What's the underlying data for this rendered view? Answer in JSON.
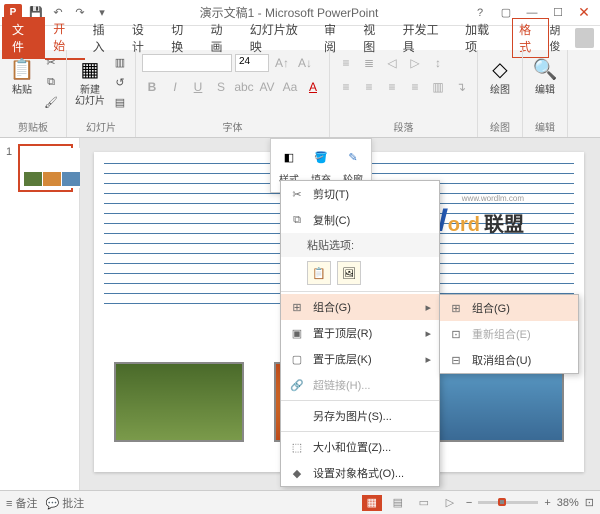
{
  "titlebar": {
    "title": "演示文稿1 - Microsoft PowerPoint",
    "app_letter": "P"
  },
  "tabs": {
    "file": "文件",
    "home": "开始",
    "insert": "插入",
    "design": "设计",
    "transitions": "切换",
    "animations": "动画",
    "slideshow": "幻灯片放映",
    "review": "审阅",
    "view": "视图",
    "developer": "开发工具",
    "addins": "加载项",
    "format": "格式",
    "username": "胡俊"
  },
  "ribbon": {
    "clipboard": {
      "label": "剪贴板",
      "paste": "粘贴"
    },
    "slides": {
      "label": "幻灯片",
      "new_slide": "新建\n幻灯片"
    },
    "font": {
      "label": "字体",
      "size": "24"
    },
    "paragraph": {
      "label": "段落"
    },
    "drawing": {
      "label": "绘图",
      "btn": "绘图"
    },
    "editing": {
      "label": "编辑",
      "btn": "编辑"
    }
  },
  "drawing_tools": {
    "style": "样式",
    "fill": "填充",
    "outline": "轮廓"
  },
  "context_menu": {
    "cut": "剪切(T)",
    "copy": "复制(C)",
    "paste_options": "粘贴选项:",
    "group": "组合(G)",
    "bring_front": "置于顶层(R)",
    "send_back": "置于底层(K)",
    "hyperlink": "超链接(H)...",
    "save_as_pic": "另存为图片(S)...",
    "size_position": "大小和位置(Z)...",
    "format_object": "设置对象格式(O)..."
  },
  "submenu": {
    "group": "组合(G)",
    "regroup": "重新组合(E)",
    "ungroup": "取消组合(U)"
  },
  "watermark": {
    "w": "W",
    "ord": "ord",
    "cn": "联盟",
    "url": "www.wordlm.com"
  },
  "statusbar": {
    "notes": "备注",
    "comments": "批注",
    "zoom": "38%"
  },
  "thumb": {
    "num": "1"
  }
}
